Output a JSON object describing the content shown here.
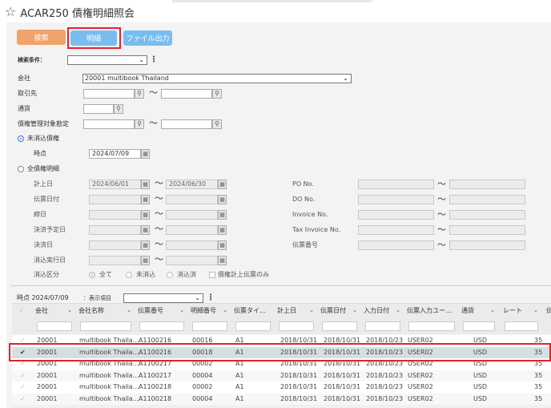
{
  "window": {
    "title": "ACAR250 債権明細照会"
  },
  "toolbar": {
    "search_label": "検索",
    "detail_label": "明細",
    "file_output_label": "ファイル出力"
  },
  "form": {
    "search_condition_label": "検索条件：",
    "company_label": "会社",
    "company_value": "20001 multibook Thailand",
    "partner_label": "取引先",
    "currency_label": "通貨",
    "account_label": "債権管理対象勘定",
    "unpaid_label": "未消込債権",
    "point_label": "時点",
    "point_value": "2024/07/09",
    "all_label": "全債権明細",
    "accrual_date_label": "計上日",
    "accrual_from": "2024/06/01",
    "accrual_to": "2024/06/30",
    "slip_date_label": "伝票日付",
    "due_date_label": "締日",
    "settle_plan_label": "決済予定日",
    "settle_date_label": "決済日",
    "clear_date_label": "消込実行日",
    "clear_type_label": "消込区分",
    "clear_all": "全て",
    "clear_none": "未消込",
    "clear_done": "消込済",
    "accrual_only": "債権計上伝票のみ",
    "po_label": "PO No.",
    "do_label": "DO No.",
    "invoice_label": "Invoice No.",
    "tax_invoice_label": "Tax Invoice No.",
    "slip_no_label": "伝票番号",
    "tilde": "〜"
  },
  "grid": {
    "point_text": "時点 2024/07/09",
    "display_label": "：表示項目",
    "columns": [
      "会社",
      "会社名称",
      "伝票番号",
      "明細番号",
      "伝票タイ…",
      "計上日",
      "伝票日付",
      "入力日付",
      "伝票入力ユー…",
      "通貨",
      "レート",
      "伝"
    ],
    "rows": [
      [
        "20001",
        "multibook Thaila…",
        "A1100216",
        "00016",
        "A1",
        "2018/10/31",
        "2018/10/31",
        "2018/10/23",
        "USER02",
        "USD",
        "35"
      ],
      [
        "20001",
        "multibook Thaila…",
        "A1100216",
        "00018",
        "A1",
        "2018/10/31",
        "2018/10/31",
        "2018/10/23",
        "USER02",
        "USD",
        "35"
      ],
      [
        "20001",
        "multibook Thaila…",
        "A1100217",
        "00002",
        "A1",
        "2018/10/31",
        "2018/10/31",
        "2018/10/23",
        "USER02",
        "USD",
        "35"
      ],
      [
        "20001",
        "multibook Thaila…",
        "A1100217",
        "00004",
        "A1",
        "2018/10/31",
        "2018/10/31",
        "2018/10/23",
        "USER02",
        "USD",
        "35"
      ],
      [
        "20001",
        "multibook Thaila…",
        "A1100218",
        "00002",
        "A1",
        "2018/10/31",
        "2018/10/31",
        "2018/10/23",
        "USER02",
        "USD",
        "35"
      ],
      [
        "20001",
        "multibook Thaila…",
        "A1100218",
        "00004",
        "A1",
        "2018/10/31",
        "2018/10/31",
        "2018/10/23",
        "USER02",
        "USD",
        "35"
      ]
    ]
  },
  "colors": {
    "accent_orange": "#f0a36b",
    "accent_blue": "#79bdf0",
    "highlight_red": "#e0222f",
    "selected_row": "#d4dfe4"
  }
}
